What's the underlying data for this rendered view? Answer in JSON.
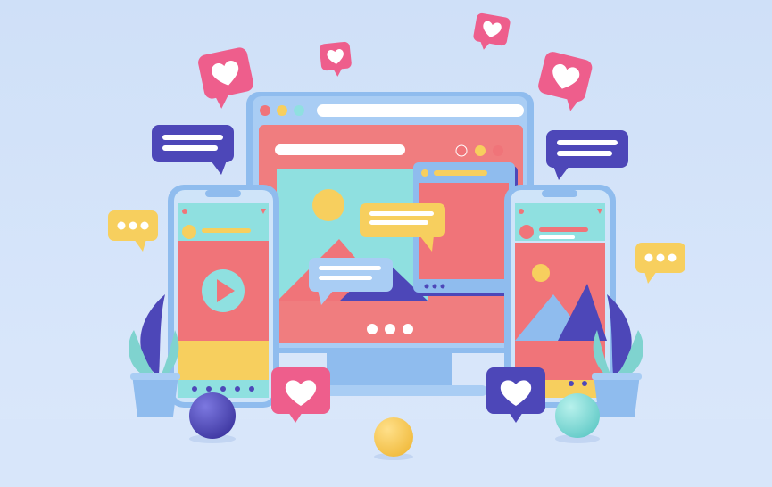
{
  "scene": {
    "palette": {
      "background": "#c9dcf7",
      "background_light": "#dbe8fb",
      "monitor_frame": "#8fbcee",
      "monitor_screen": "#f07d7f",
      "coral": "#f07479",
      "teal": "#8fe0e0",
      "yellow": "#f7cf5e",
      "purple": "#4d47b8",
      "pink": "#ee5e8c",
      "white": "#ffffff"
    },
    "icons": [
      "heart-icon",
      "chat-bubble-icon",
      "typing-dots-icon",
      "play-icon",
      "image-placeholder-icon",
      "plant-icon",
      "sphere-icon"
    ]
  }
}
